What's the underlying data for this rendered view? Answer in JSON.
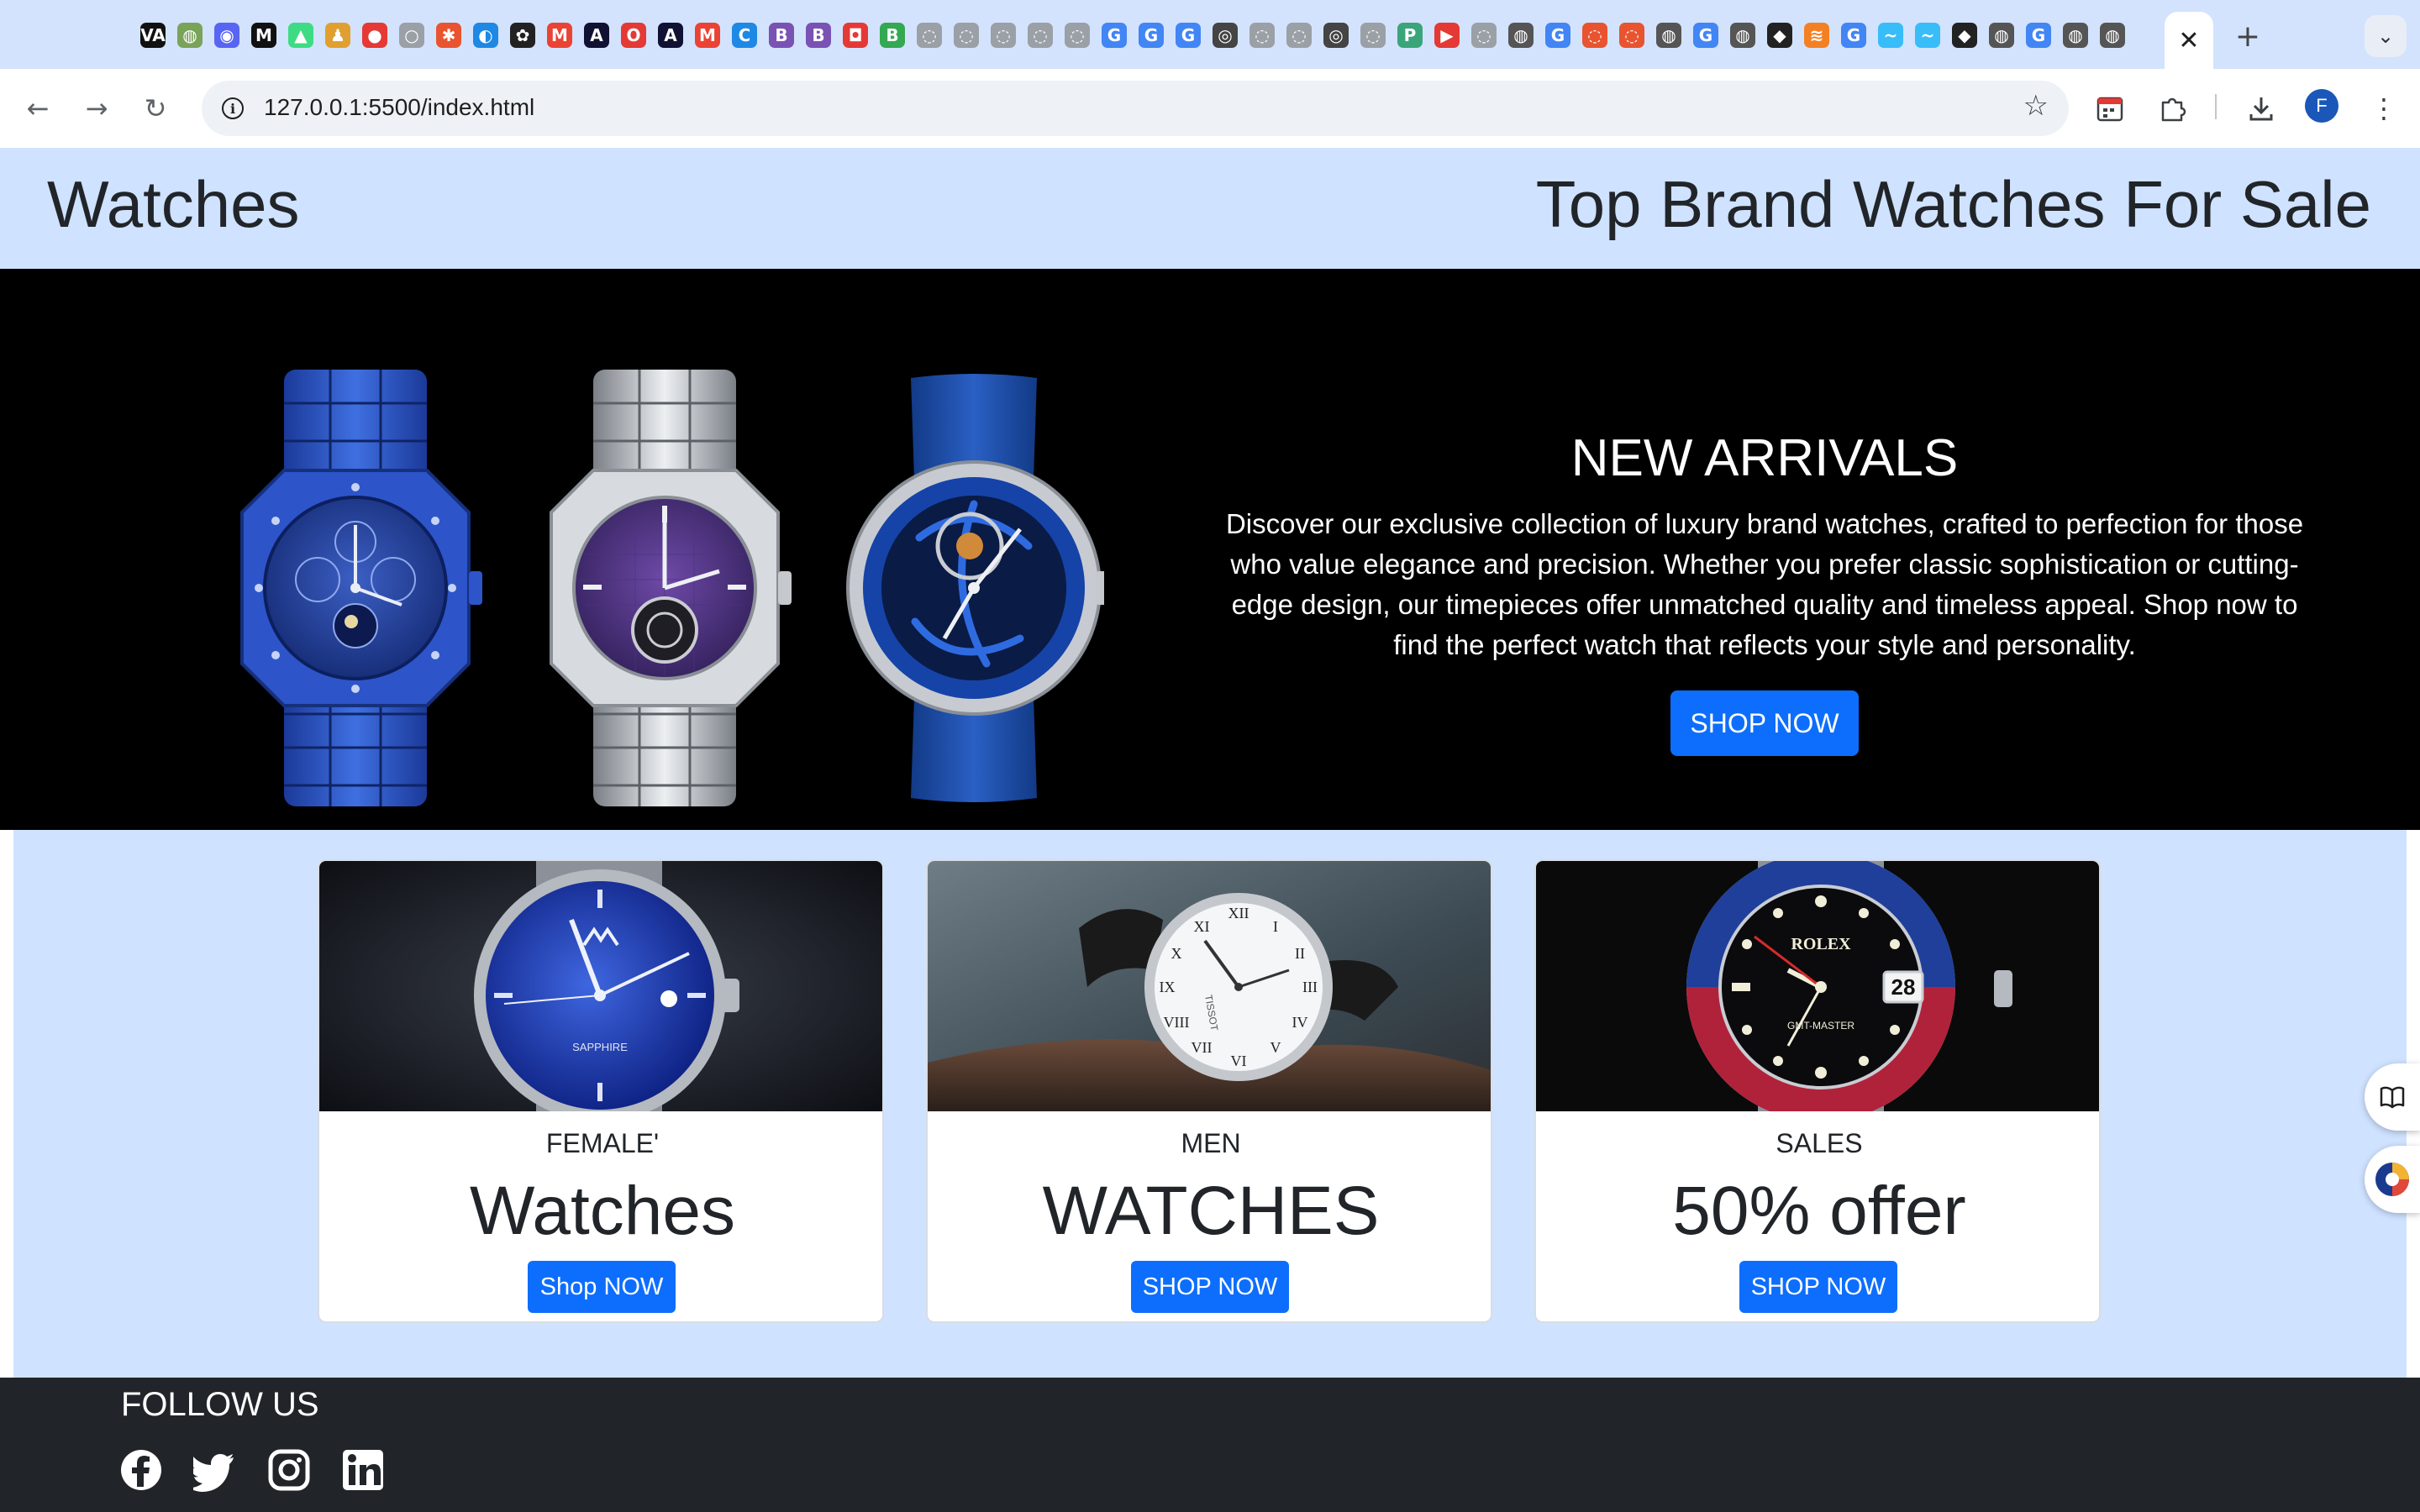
{
  "browser": {
    "url": "127.0.0.1:5500/index.html",
    "profile_initial": "F",
    "favicons": [
      {
        "glyph": "VA",
        "color": "#111111"
      },
      {
        "glyph": "◍",
        "color": "#7aa35a"
      },
      {
        "glyph": "◉",
        "color": "#5865f2"
      },
      {
        "glyph": "M",
        "color": "#111111"
      },
      {
        "glyph": "▲",
        "color": "#3ddc84"
      },
      {
        "glyph": "♟",
        "color": "#e0a030"
      },
      {
        "glyph": "●",
        "color": "#e53935"
      },
      {
        "glyph": "○",
        "color": "#9aa0a6"
      },
      {
        "glyph": "✱",
        "color": "#e8542f"
      },
      {
        "glyph": "◐",
        "color": "#1e88e5"
      },
      {
        "glyph": "✿",
        "color": "#222222"
      },
      {
        "glyph": "M",
        "color": "#ea4335"
      },
      {
        "glyph": "A",
        "color": "#111133"
      },
      {
        "glyph": "O",
        "color": "#e53935"
      },
      {
        "glyph": "A",
        "color": "#111133"
      },
      {
        "glyph": "M",
        "color": "#ea4335"
      },
      {
        "glyph": "C",
        "color": "#1e88e5"
      },
      {
        "glyph": "B",
        "color": "#7952b3"
      },
      {
        "glyph": "B",
        "color": "#7952b3"
      },
      {
        "glyph": "◘",
        "color": "#e53935"
      },
      {
        "glyph": "B",
        "color": "#34a853"
      },
      {
        "glyph": "◌",
        "color": "#9aa0a6"
      },
      {
        "glyph": "◌",
        "color": "#9aa0a6"
      },
      {
        "glyph": "◌",
        "color": "#9aa0a6"
      },
      {
        "glyph": "◌",
        "color": "#9aa0a6"
      },
      {
        "glyph": "◌",
        "color": "#9aa0a6"
      },
      {
        "glyph": "G",
        "color": "#4285f4"
      },
      {
        "glyph": "G",
        "color": "#4285f4"
      },
      {
        "glyph": "G",
        "color": "#4285f4"
      },
      {
        "glyph": "◎",
        "color": "#444444"
      },
      {
        "glyph": "◌",
        "color": "#9aa0a6"
      },
      {
        "glyph": "◌",
        "color": "#9aa0a6"
      },
      {
        "glyph": "◎",
        "color": "#444444"
      },
      {
        "glyph": "◌",
        "color": "#9aa0a6"
      },
      {
        "glyph": "P",
        "color": "#3aa57a"
      },
      {
        "glyph": "▶",
        "color": "#e53935"
      },
      {
        "glyph": "◌",
        "color": "#9aa0a6"
      },
      {
        "glyph": "◍",
        "color": "#555555"
      },
      {
        "glyph": "G",
        "color": "#4285f4"
      },
      {
        "glyph": "◌",
        "color": "#e8542f"
      },
      {
        "glyph": "◌",
        "color": "#e8542f"
      },
      {
        "glyph": "◍",
        "color": "#555555"
      },
      {
        "glyph": "G",
        "color": "#4285f4"
      },
      {
        "glyph": "◍",
        "color": "#555555"
      },
      {
        "glyph": "◆",
        "color": "#222222"
      },
      {
        "glyph": "≋",
        "color": "#f48024"
      },
      {
        "glyph": "G",
        "color": "#4285f4"
      },
      {
        "glyph": "~",
        "color": "#38bdf8"
      },
      {
        "glyph": "~",
        "color": "#38bdf8"
      },
      {
        "glyph": "◆",
        "color": "#222222"
      },
      {
        "glyph": "◍",
        "color": "#555555"
      },
      {
        "glyph": "G",
        "color": "#4285f4"
      },
      {
        "glyph": "◍",
        "color": "#555555"
      },
      {
        "glyph": "◍",
        "color": "#555555"
      }
    ]
  },
  "header": {
    "brand": "Watches",
    "tagline": "Top Brand Watches For Sale"
  },
  "hero": {
    "title": "NEW ARRIVALS",
    "description": "Discover our exclusive collection of luxury brand watches, crafted to perfection for those who value elegance and precision. Whether you prefer classic sophistication or cutting-edge design, our timepieces offer unmatched quality and timeless appeal. Shop now to find the perfect watch that reflects your style and personality.",
    "button": "SHOP NOW"
  },
  "cards": [
    {
      "subtitle": "FEMALE'",
      "title": "Watches",
      "button": "Shop NOW",
      "dial_text": "SAPPHIRE"
    },
    {
      "subtitle": "MEN",
      "title": "WATCHES",
      "button": "SHOP NOW",
      "dial_text": "TISSOT"
    },
    {
      "subtitle": "SALES",
      "title": "50% offer",
      "button": "SHOP NOW",
      "dial_text": "ROLEX",
      "dial_text_2": "GMT-MASTER",
      "dial_date": "28"
    }
  ],
  "footer": {
    "follow": "FOLLOW US"
  }
}
